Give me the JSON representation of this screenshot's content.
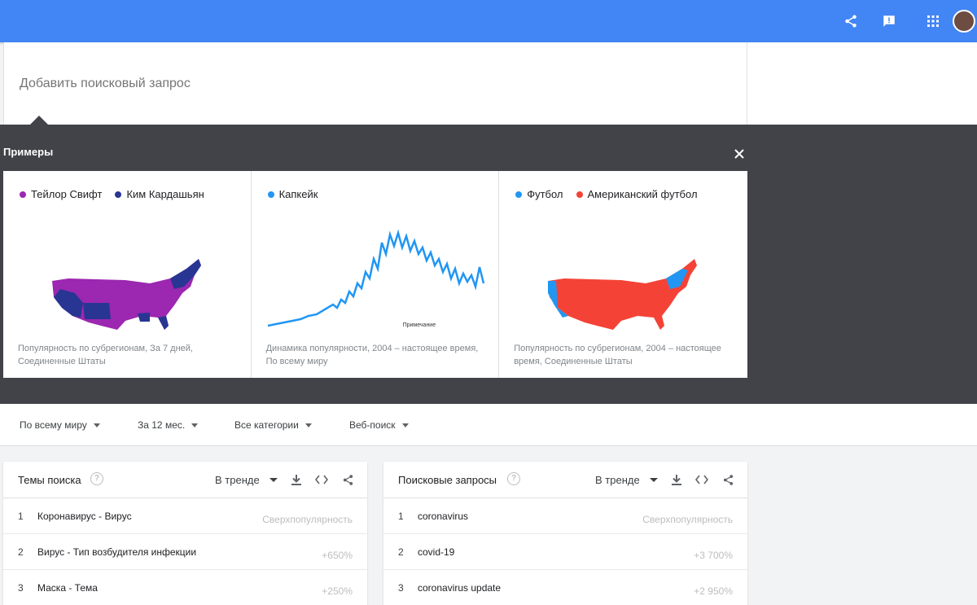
{
  "colors": {
    "appbar": "#4285f4",
    "overlay": "#424348",
    "purple": "#9c27b0",
    "navy": "#283593",
    "blue": "#2196f3",
    "red": "#f44336"
  },
  "search": {
    "placeholder": "Добавить поисковый запрос"
  },
  "examples": {
    "title": "Примеры",
    "cards": [
      {
        "legend": [
          {
            "label": "Тейлор Свифт",
            "color": "#9c27b0"
          },
          {
            "label": "Ким Кардашьян",
            "color": "#283593"
          }
        ],
        "caption": "Популярность по субрегионам, За 7 дней, Соединенные Штаты"
      },
      {
        "legend": [
          {
            "label": "Капкейк",
            "color": "#2196f3"
          }
        ],
        "note": "Примечание",
        "caption": "Динамика популярности, 2004 – настоящее время, По всему миру"
      },
      {
        "legend": [
          {
            "label": "Футбол",
            "color": "#2196f3"
          },
          {
            "label": "Американский футбол",
            "color": "#f44336"
          }
        ],
        "caption": "Популярность по субрегионам, 2004 – настоящее время, Соединенные Штаты"
      }
    ]
  },
  "filters": {
    "region": "По всему миру",
    "period": "За 12 мес.",
    "category": "Все категории",
    "type": "Веб-поиск"
  },
  "widgets": [
    {
      "title": "Темы поиска",
      "selector": "В тренде",
      "rows": [
        {
          "num": "1",
          "name": "Коронавирус - Вирус",
          "value": "Сверхпопулярность"
        },
        {
          "num": "2",
          "name": "Вирус - Тип возбудителя инфекции",
          "value": "+650%"
        },
        {
          "num": "3",
          "name": "Маска - Тема",
          "value": "+250%"
        }
      ]
    },
    {
      "title": "Поисковые запросы",
      "selector": "В тренде",
      "rows": [
        {
          "num": "1",
          "name": "coronavirus",
          "value": "Сверхпопулярность"
        },
        {
          "num": "2",
          "name": "covid-19",
          "value": "+3 700%"
        },
        {
          "num": "3",
          "name": "coronavirus update",
          "value": "+2 950%"
        }
      ]
    }
  ]
}
